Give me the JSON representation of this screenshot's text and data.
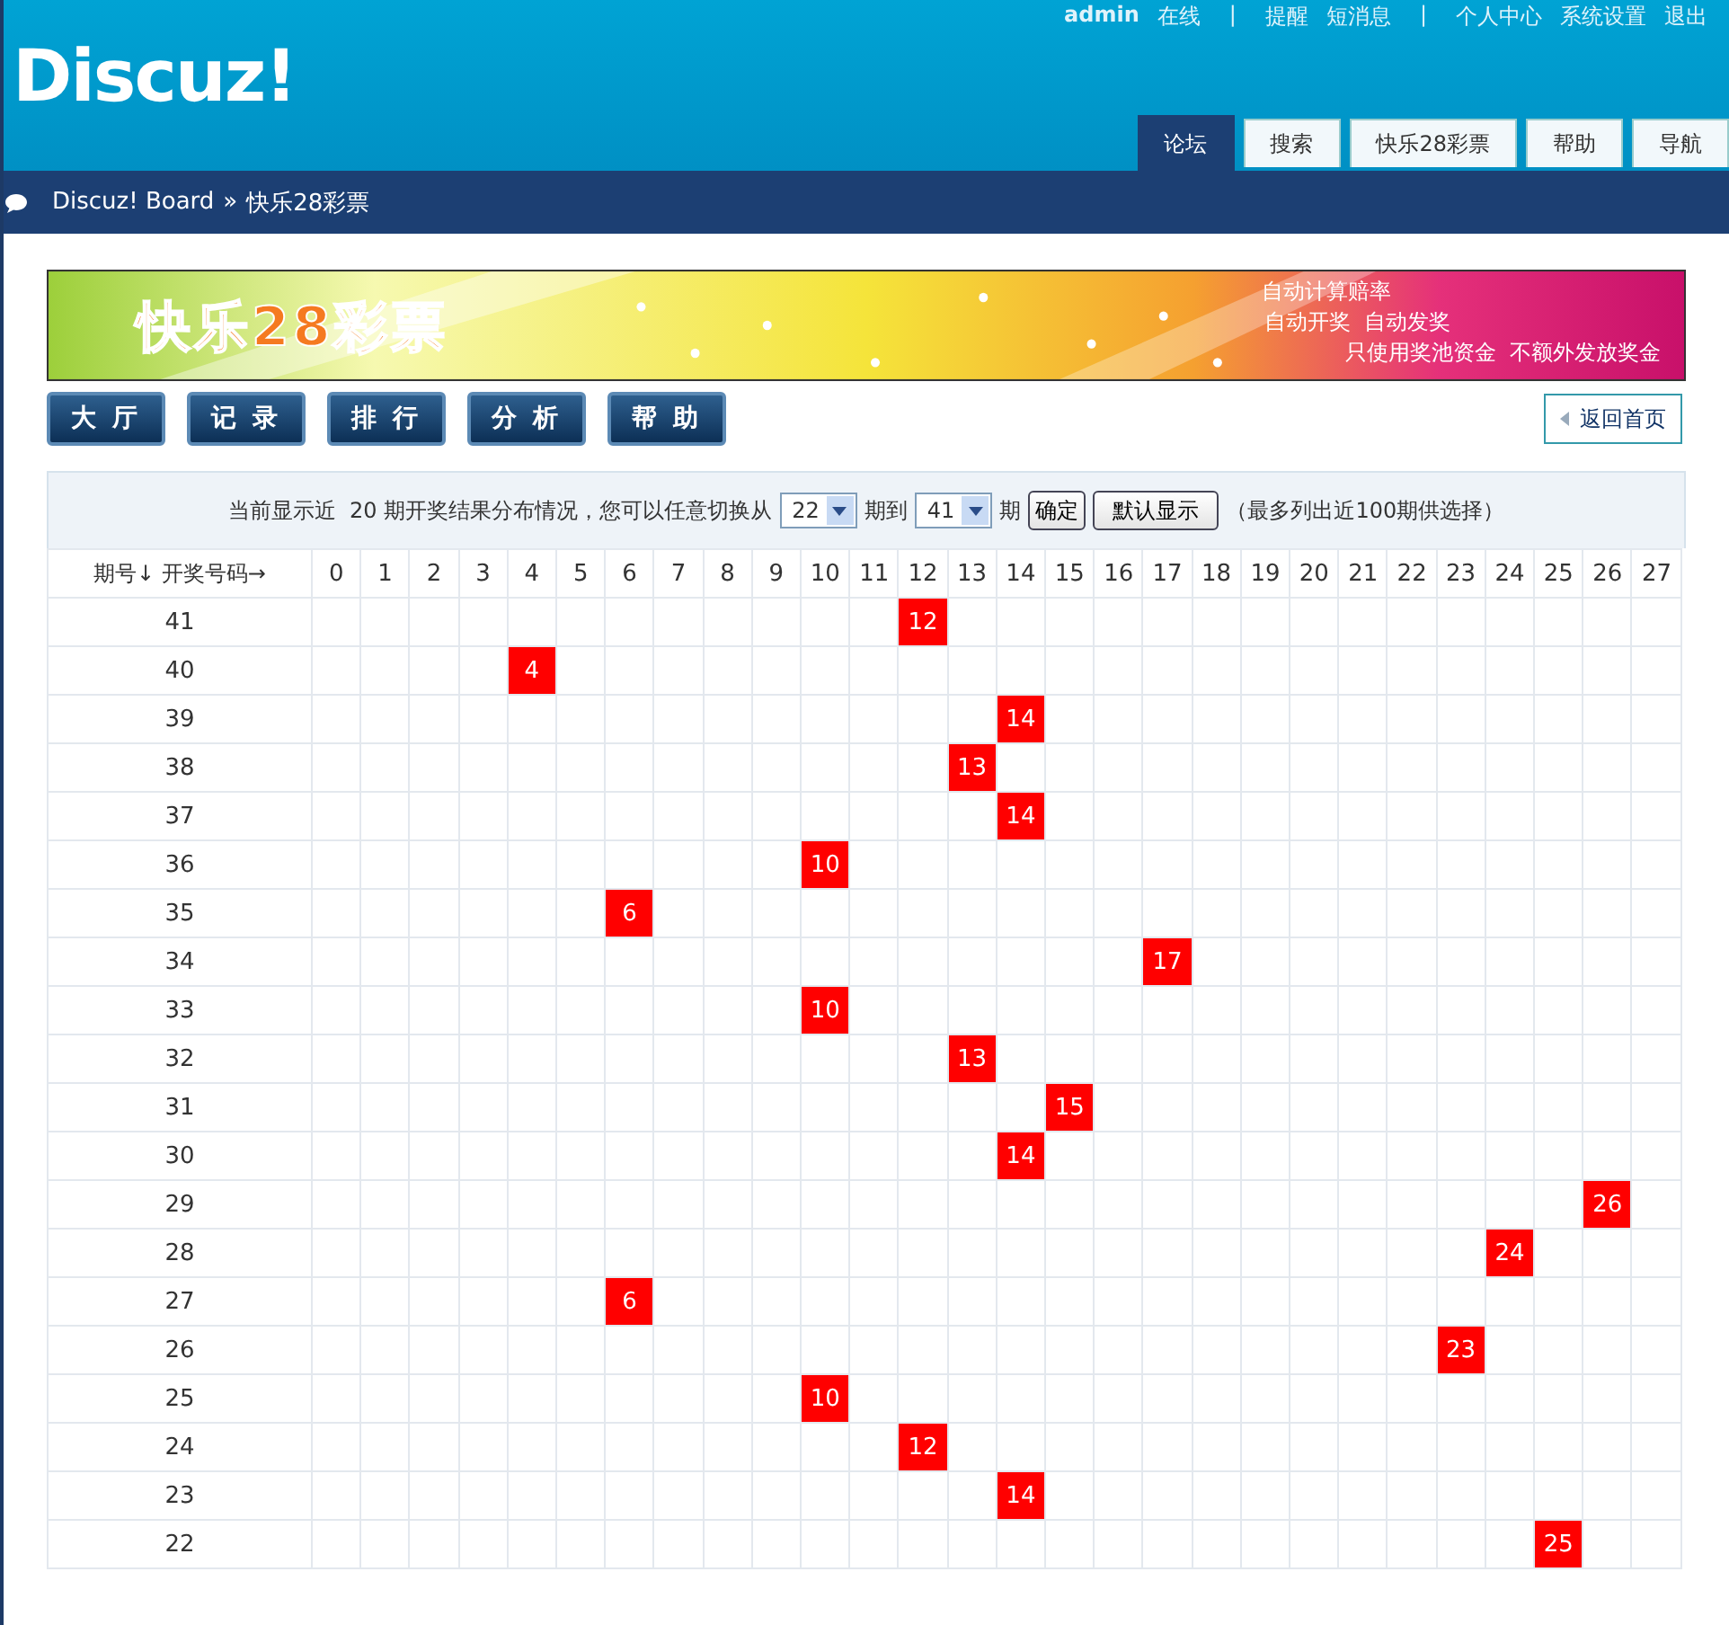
{
  "top_links": [
    {
      "label": "admin",
      "kind": "user"
    },
    {
      "label": "在线",
      "kind": "link"
    },
    {
      "label": "|",
      "kind": "separator"
    },
    {
      "label": "提醒",
      "kind": "link"
    },
    {
      "label": "短消息",
      "kind": "link"
    },
    {
      "label": "|",
      "kind": "separator"
    },
    {
      "label": "个人中心",
      "kind": "link"
    },
    {
      "label": "系统设置",
      "kind": "link"
    },
    {
      "label": "退出",
      "kind": "link"
    }
  ],
  "logo": "Discuz!",
  "nav_tabs": [
    {
      "label": "论坛",
      "selected": true
    },
    {
      "label": "搜索",
      "selected": false
    },
    {
      "label": "快乐28彩票",
      "selected": false
    },
    {
      "label": "帮助",
      "selected": false
    },
    {
      "label": "导航",
      "selected": false
    }
  ],
  "breadcrumb": {
    "home": "Discuz! Board",
    "separator": "»",
    "current": "快乐28彩票"
  },
  "banner": {
    "title": "快乐28彩票",
    "slogans": [
      "自动计算赔率",
      "自动开奖  自动发奖",
      "只使用奖池资金  不额外发放奖金"
    ]
  },
  "menu_buttons": [
    "大 厅",
    "记 录",
    "排 行",
    "分 析",
    "帮 助"
  ],
  "back_button": "返回首页",
  "filter": {
    "text_before": "当前显示近  20 期开奖结果分布情况，您可以任意切换从",
    "from": "22",
    "text_middle": "期到",
    "to": "41",
    "text_after": "期",
    "confirm": "确定",
    "default": "默认显示",
    "note": "（最多列出近100期供选择）"
  },
  "table": {
    "corner": "期号↓ 开奖号码→",
    "columns": [
      "0",
      "1",
      "2",
      "3",
      "4",
      "5",
      "6",
      "7",
      "8",
      "9",
      "10",
      "11",
      "12",
      "13",
      "14",
      "15",
      "16",
      "17",
      "18",
      "19",
      "20",
      "21",
      "22",
      "23",
      "24",
      "25",
      "26",
      "27"
    ],
    "rows": [
      {
        "period": "41",
        "result": "12"
      },
      {
        "period": "40",
        "result": "4"
      },
      {
        "period": "39",
        "result": "14"
      },
      {
        "period": "38",
        "result": "13"
      },
      {
        "period": "37",
        "result": "14"
      },
      {
        "period": "36",
        "result": "10"
      },
      {
        "period": "35",
        "result": "6"
      },
      {
        "period": "34",
        "result": "17"
      },
      {
        "period": "33",
        "result": "10"
      },
      {
        "period": "32",
        "result": "13"
      },
      {
        "period": "31",
        "result": "15"
      },
      {
        "period": "30",
        "result": "14"
      },
      {
        "period": "29",
        "result": "26"
      },
      {
        "period": "28",
        "result": "24"
      },
      {
        "period": "27",
        "result": "6"
      },
      {
        "period": "26",
        "result": "23"
      },
      {
        "period": "25",
        "result": "10"
      },
      {
        "period": "24",
        "result": "12"
      },
      {
        "period": "23",
        "result": "14"
      },
      {
        "period": "22",
        "result": "25"
      }
    ]
  }
}
